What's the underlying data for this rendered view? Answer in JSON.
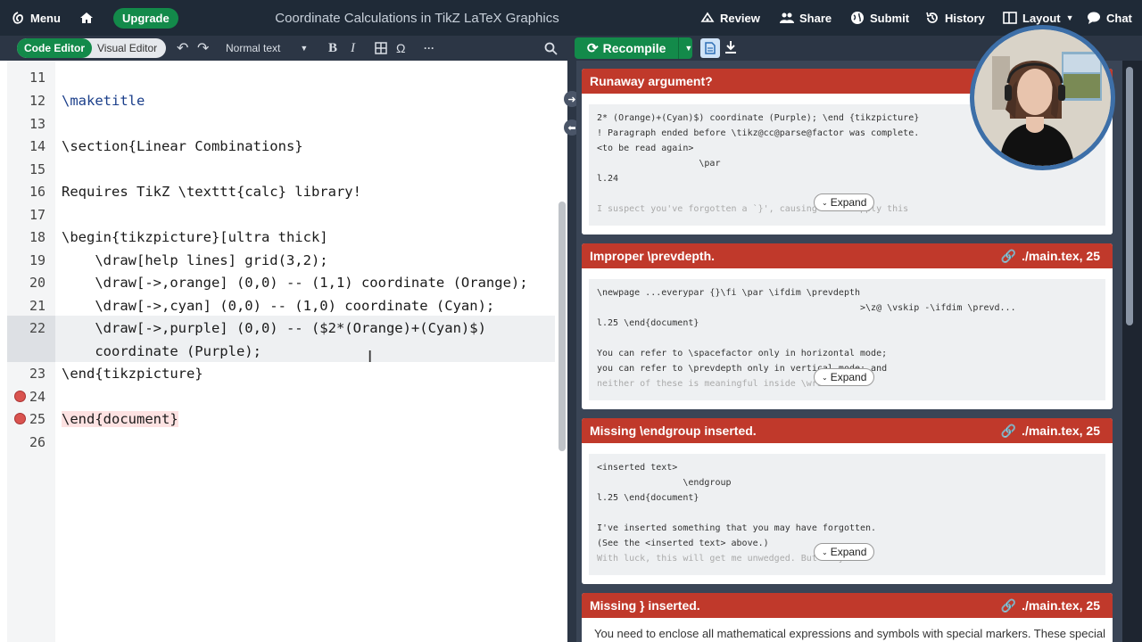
{
  "topbar": {
    "menu_label": "Menu",
    "upgrade_label": "Upgrade",
    "title": "Coordinate Calculations in TikZ LaTeX Graphics",
    "review_label": "Review",
    "share_label": "Share",
    "submit_label": "Submit",
    "history_label": "History",
    "layout_label": "Layout",
    "chat_label": "Chat"
  },
  "toolbar": {
    "code_editor_label": "Code Editor",
    "visual_editor_label": "Visual Editor",
    "style_select_value": "Normal text",
    "bold_label": "B",
    "italic_label": "I",
    "omega_label": "Ω",
    "more_label": "···"
  },
  "preview_toolbar": {
    "recompile_label": "Recompile"
  },
  "editor": {
    "lines": [
      {
        "no": "11",
        "text": ""
      },
      {
        "no": "12",
        "text": "\\maketitle"
      },
      {
        "no": "13",
        "text": ""
      },
      {
        "no": "14",
        "text": "\\section{Linear Combinations}"
      },
      {
        "no": "15",
        "text": ""
      },
      {
        "no": "16",
        "text": "Requires TikZ \\texttt{calc} library!"
      },
      {
        "no": "17",
        "text": ""
      },
      {
        "no": "18",
        "text": "\\begin{tikzpicture}[ultra thick]"
      },
      {
        "no": "19",
        "text": "    \\draw[help lines] grid(3,2);"
      },
      {
        "no": "20",
        "text": "    \\draw[->,orange] (0,0) -- (1,1) coordinate (Orange);"
      },
      {
        "no": "21",
        "text": "    \\draw[->,cyan] (0,0) -- (1,0) coordinate (Cyan);"
      },
      {
        "no": "22",
        "text": "    \\draw[->,purple] (0,0) -- ($2*(Orange)+(Cyan)$)"
      },
      {
        "no": "",
        "text": "    coordinate (Purple);"
      },
      {
        "no": "23",
        "text": "\\end{tikzpicture}"
      },
      {
        "no": "24",
        "text": ""
      },
      {
        "no": "25",
        "text": "\\end{document}"
      },
      {
        "no": "26",
        "text": ""
      }
    ]
  },
  "log": {
    "cards": [
      {
        "title": "Runaway argument?",
        "location": "",
        "lines": [
          "2* (Orange)+(Cyan)$) coordinate (Purple); \\end {tikzpicture}",
          "! Paragraph ended before \\tikz@cc@parse@factor was complete.",
          "<to be read again>",
          "                   \\par",
          "l.24",
          "",
          "I suspect you've forgotten a `}', causing me to apply this"
        ],
        "expand_label": "Expand"
      },
      {
        "title": "Improper \\prevdepth.",
        "location": "./main.tex, 25",
        "lines": [
          "\\newpage ...everypar {}\\fi \\par \\ifdim \\prevdepth",
          "                                                 >\\z@ \\vskip -\\ifdim \\prevd...",
          "l.25 \\end{document}",
          "",
          "You can refer to \\spacefactor only in horizontal mode;",
          "you can refer to \\prevdepth only in vertical mode; and",
          "neither of these is meaningful inside \\write. So"
        ],
        "expand_label": "Expand"
      },
      {
        "title": "Missing \\endgroup inserted.",
        "location": "./main.tex, 25",
        "lines": [
          "<inserted text>",
          "                \\endgroup",
          "l.25 \\end{document}",
          "",
          "I've inserted something that you may have forgotten.",
          "(See the <inserted text> above.)",
          "With luck, this will get me unwedged. But if you"
        ],
        "expand_label": "Expand"
      },
      {
        "title": "Missing } inserted.",
        "location": "./main.tex, 25",
        "text": "You need to enclose all mathematical expressions and symbols with special markers. These special markers"
      }
    ]
  },
  "colors": {
    "accent_green": "#138a4a",
    "error_red": "#c0392b",
    "topbar_bg": "#1f2a37"
  }
}
